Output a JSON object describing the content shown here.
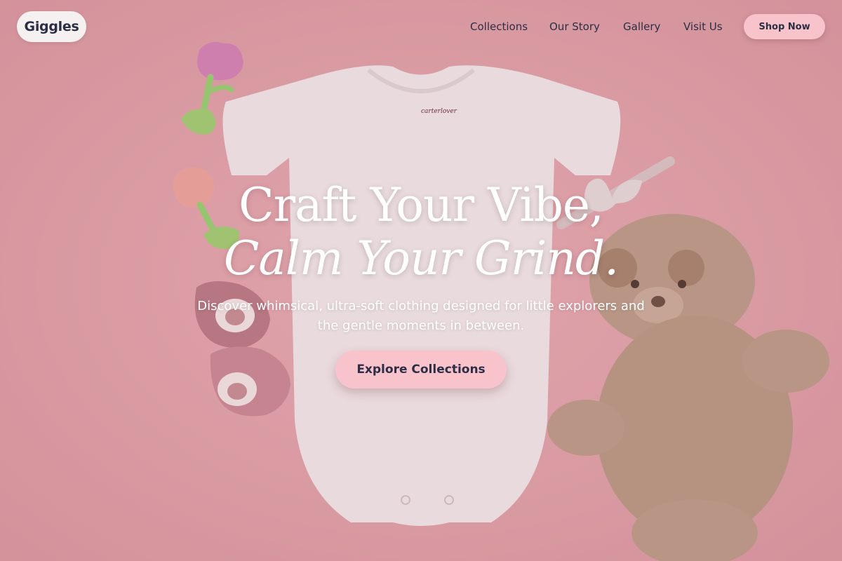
{
  "nav": {
    "logo": "Giggles",
    "links": [
      "Collections",
      "Our Story",
      "Gallery",
      "Visit Us"
    ],
    "cta": "Shop Now"
  },
  "hero": {
    "title_line1": "Craft Your Vibe,",
    "title_line2": "Calm Your Grind.",
    "subtitle": "Discover whimsical, ultra-soft clothing designed for little explorers and the gentle moments in between.",
    "cta": "Explore Collections",
    "onesie_label": "carterlover"
  },
  "colors": {
    "background": "#e2a3aa",
    "button": "#f9c3cb",
    "text_dark": "#2b2e45",
    "text_light": "#ffffff"
  }
}
